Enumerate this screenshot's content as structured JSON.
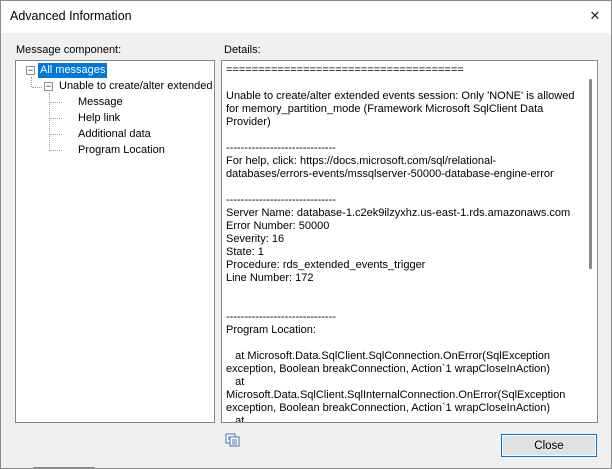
{
  "window": {
    "title": "Advanced Information",
    "close_glyph": "✕"
  },
  "left": {
    "label": "Message component:",
    "tree": {
      "root": "All messages",
      "child": "Unable to create/alter extended",
      "items": [
        "Message",
        "Help link",
        "Additional data",
        "Program Location"
      ]
    },
    "expander_glyph": "−"
  },
  "right": {
    "label": "Details:",
    "text": "=====================================\n\nUnable to create/alter extended events session: Only 'NONE' is allowed for memory_partition_mode (Framework Microsoft SqlClient Data Provider)\n\n------------------------------\nFor help, click: https://docs.microsoft.com/sql/relational-databases/errors-events/mssqlserver-50000-database-engine-error\n\n------------------------------\nServer Name: database-1.c2ek9ilzyxhz.us-east-1.rds.amazonaws.com\nError Number: 50000\nSeverity: 16\nState: 1\nProcedure: rds_extended_events_trigger\nLine Number: 172\n\n\n------------------------------\nProgram Location:\n\n   at Microsoft.Data.SqlClient.SqlConnection.OnError(SqlException exception, Boolean breakConnection, Action`1 wrapCloseInAction)\n   at Microsoft.Data.SqlClient.SqlInternalConnection.OnError(SqlException exception, Boolean breakConnection, Action`1 wrapCloseInAction)\n   at Microsoft.Data.SqlClient.TdsParser.ThrowExceptionAndWarning(TdsParserStateObject stateObj, Boolean callerHasConnectionLock, Boolean asyncClose)"
  },
  "footer": {
    "copy_icon": "copy-icon",
    "close_label": "Close"
  },
  "colors": {
    "selection": "#0078d7",
    "panel_border": "#828790",
    "background": "#f0f0f0"
  }
}
